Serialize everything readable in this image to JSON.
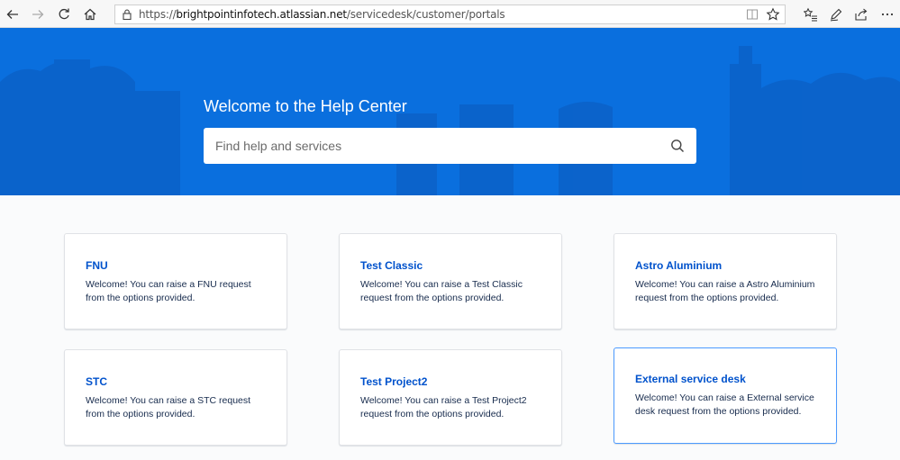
{
  "browser": {
    "url_prefix": "https://",
    "url_domain": "brightpointinfotech.atlassian.net",
    "url_path": "/servicedesk/customer/portals"
  },
  "hero": {
    "title": "Welcome to the Help Center",
    "search_placeholder": "Find help and services"
  },
  "colors": {
    "hero_blue": "#0a6fde",
    "link_blue": "#0052cc",
    "selected_border": "#4c9aff"
  },
  "portals": [
    {
      "title": "FNU",
      "description": "Welcome! You can raise a FNU request from the options provided."
    },
    {
      "title": "Test Classic",
      "description": "Welcome! You can raise a Test Classic request from the options provided."
    },
    {
      "title": "Astro Aluminium",
      "description": "Welcome! You can raise a Astro Aluminium request from the options provided."
    },
    {
      "title": "STC",
      "description": "Welcome! You can raise a STC request from the options provided."
    },
    {
      "title": "Test Project2",
      "description": "Welcome! You can raise a Test Project2 request from the options provided."
    },
    {
      "title": "External service desk",
      "description": "Welcome! You can raise a External service desk request from the options provided."
    }
  ]
}
